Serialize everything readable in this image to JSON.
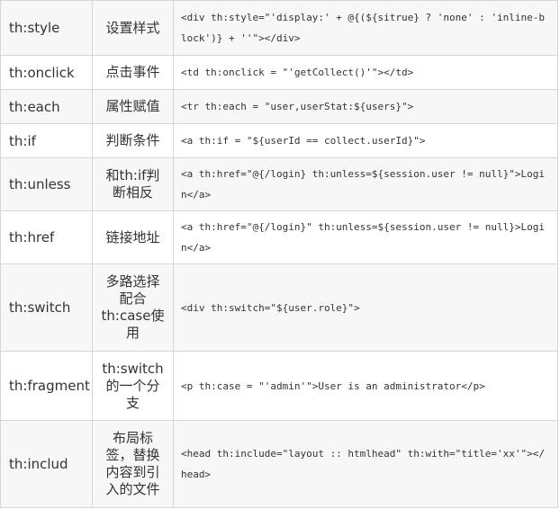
{
  "rows": [
    {
      "attr": "th:style",
      "desc": "设置样式",
      "code": "<div th:style=\"'display:' + @{(${sitrue} ? 'none' : 'inline-block')} + ''\"></div>"
    },
    {
      "attr": "th:onclick",
      "desc": "点击事件",
      "code": "<td th:onclick = \"'getCollect()'\"></td>"
    },
    {
      "attr": "th:each",
      "desc": "属性赋值",
      "code": "<tr th:each = \"user,userStat:${users}\">"
    },
    {
      "attr": "th:if",
      "desc": "判断条件",
      "code": "<a th:if = \"${userId == collect.userId}\">"
    },
    {
      "attr": "th:unless",
      "desc": "和th:if判断相反",
      "code": "<a th:href=\"@{/login} th:unless=${session.user != null}\">Login</a>"
    },
    {
      "attr": "th:href",
      "desc": "链接地址",
      "code": "<a th:href=\"@{/login}\" th:unless=${session.user != null}>Login</a>"
    },
    {
      "attr": "th:switch",
      "desc": "多路选择配合th:case使用",
      "code": "<div th:switch=\"${user.role}\">"
    },
    {
      "attr": "th:fragment",
      "desc": "th:switch的一个分支",
      "code": "<p th:case = \"'admin'\">User is an administrator</p>"
    },
    {
      "attr": "th:includ",
      "desc": "布局标签，替换内容到引入的文件",
      "code": "<head th:include=\"layout :: htmlhead\" th:with=\"title='xx'\"></head>"
    }
  ]
}
